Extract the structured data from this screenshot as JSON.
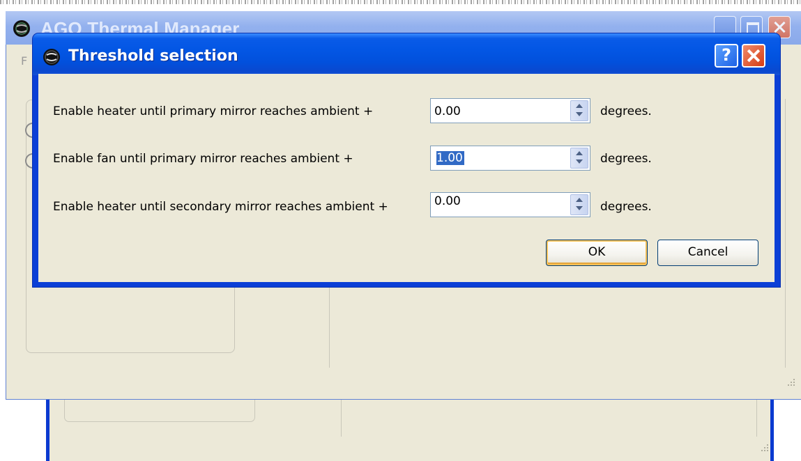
{
  "main_window": {
    "title": "AGO Thermal Manager",
    "menu_partial": "F"
  },
  "dialog": {
    "title": "Threshold selection",
    "help_label": "?",
    "rows": [
      {
        "label": "Enable heater until primary mirror reaches ambient +",
        "value": "0.00",
        "unit": "degrees."
      },
      {
        "label": "Enable fan until primary mirror reaches ambient +",
        "value": "1.00",
        "unit": "degrees."
      },
      {
        "label": "Enable heater until secondary mirror reaches ambient +",
        "value": "0.00",
        "unit": "degrees."
      }
    ],
    "ok_label": "OK",
    "cancel_label": "Cancel"
  },
  "icons": {
    "app_icon": "app-logo-icon",
    "help": "help-icon",
    "close": "close-icon",
    "spin_up": "arrow-up-icon",
    "spin_down": "arrow-down-icon"
  },
  "colors": {
    "titlebar_blue": "#0356e4",
    "dialog_face": "#ece9d8",
    "selection": "#316ac5",
    "close_red": "#d63d14",
    "default_button_glow": "#f7c25a"
  }
}
